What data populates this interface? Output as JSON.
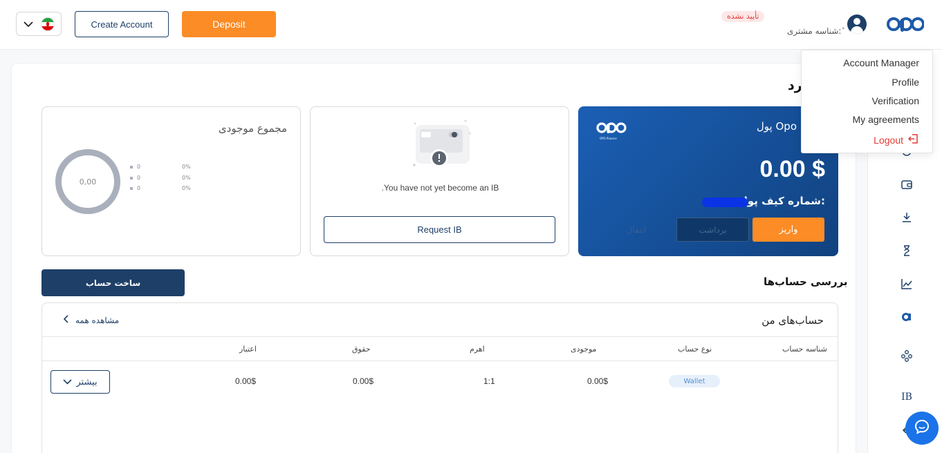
{
  "header": {
    "create_account_label": "Create Account",
    "deposit_label": "Deposit",
    "status_badge": "تأیید نشده",
    "customer_id_label": "شناسه مشتری: ٔ",
    "language_flag": "iran-flag-icon",
    "brand": "opo"
  },
  "dropdown": {
    "items": [
      {
        "label": "Account Manager"
      },
      {
        "label": "Profile"
      },
      {
        "label": "Verification"
      },
      {
        "label": "My agreements"
      }
    ],
    "logout_label": "Logout",
    "logout_color": "#e53935"
  },
  "page": {
    "title": "رد"
  },
  "total_card": {
    "title": "مجموع موجودی",
    "donut_value": "0,00",
    "legend": [
      {
        "value": "0",
        "percent": "0%"
      },
      {
        "value": "0",
        "percent": "0%"
      },
      {
        "value": "0",
        "percent": "0%"
      }
    ]
  },
  "ib_card": {
    "message": ".You have not yet become an IB",
    "request_label": "Request IB"
  },
  "wallet_card": {
    "title": "پول Opo",
    "logo_sub": "OPO finance",
    "balance": "0.00 $",
    "wallet_number_label": "شماره کیف پول:",
    "deposit_label": "واریز",
    "withdraw_label": "برداشت",
    "transfer_label": "انتقال",
    "colors": {
      "accent": "#fb8c26",
      "primary": "#1e3f68"
    }
  },
  "accounts_section": {
    "title": "بررسی حساب‌ها",
    "create_label": "ساخت حساب",
    "list_title": "حساب‌های من",
    "see_all": "مشاهده همه",
    "columns": [
      "شناسه حساب",
      "نوع حساب",
      "موجودی",
      "اهرم",
      "حقوق",
      "اعتبار"
    ],
    "rows": [
      {
        "type": "Wallet",
        "balance": "0.00$",
        "leverage": "1:1",
        "equity": "0.00$",
        "credit": "0.00$",
        "more_label": "بیشتر"
      }
    ]
  },
  "sidebar": {
    "ib_label": "IB"
  }
}
